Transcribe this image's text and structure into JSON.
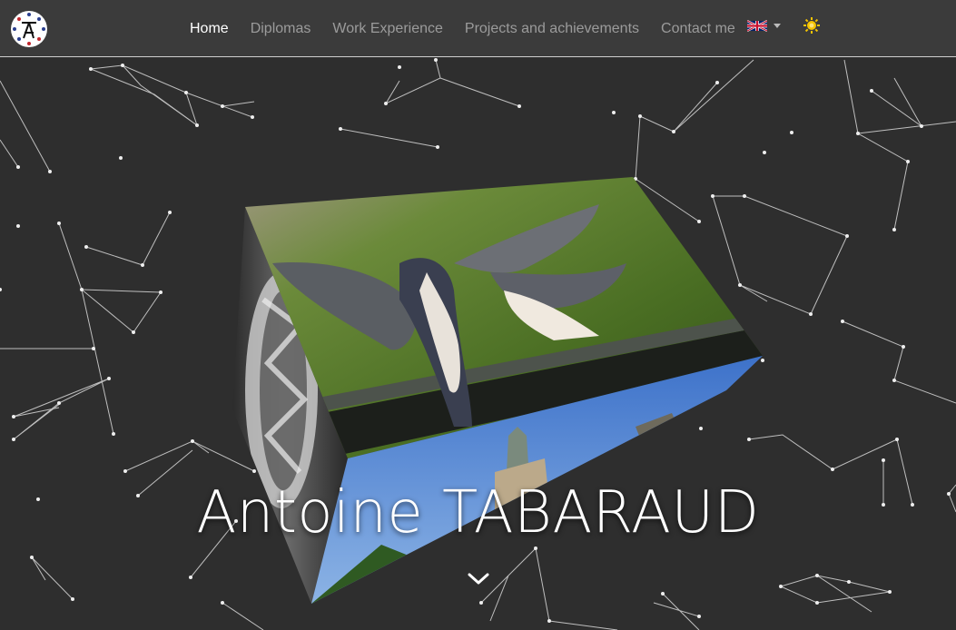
{
  "navbar": {
    "logo_icon": "monogram-logo-icon",
    "links": [
      {
        "label": "Home",
        "active": true
      },
      {
        "label": "Diplomas",
        "active": false
      },
      {
        "label": "Work Experience",
        "active": false
      },
      {
        "label": "Projects and achievements",
        "active": false
      },
      {
        "label": "Contact me",
        "active": false
      }
    ],
    "language_icon": "uk-flag-icon",
    "theme_icon": "sun-icon"
  },
  "hero": {
    "name": "Antoine TABARAUD",
    "scroll_icon": "chevron-down-icon",
    "cube_faces": [
      "swallows-photo",
      "castle-photo",
      "clock-photo"
    ]
  },
  "colors": {
    "navbar_bg": "#3b3b3b",
    "page_bg": "#2e2e2e",
    "active_link": "#ffffff",
    "inactive_link": "#9b9b9b",
    "sun": "#f5c400"
  }
}
